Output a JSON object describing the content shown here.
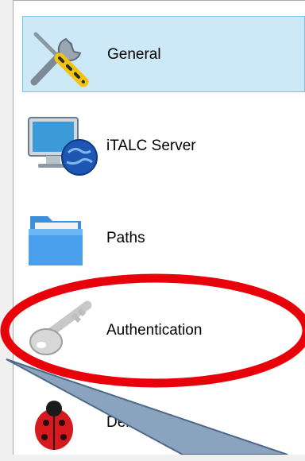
{
  "sidebar": {
    "items": [
      {
        "label": "General",
        "icon": "tools-icon",
        "selected": true
      },
      {
        "label": "iTALC Server",
        "icon": "monitor-globe-icon",
        "selected": false
      },
      {
        "label": "Paths",
        "icon": "folder-icon",
        "selected": false
      },
      {
        "label": "Authentication",
        "icon": "key-icon",
        "selected": false
      },
      {
        "label": "Debugging",
        "icon": "ladybug-icon",
        "selected": false
      }
    ]
  },
  "colors": {
    "selection_bg": "#cde8f7",
    "selection_border": "#7cc3ea",
    "annotation_ellipse": "#e8000b",
    "annotation_callout": "#8aa3be"
  }
}
